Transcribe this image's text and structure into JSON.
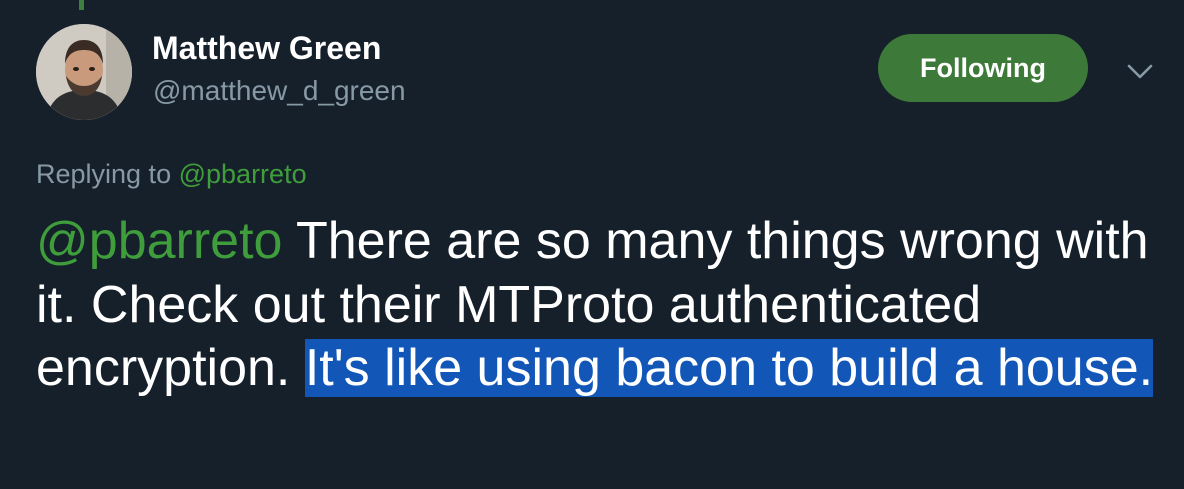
{
  "author": {
    "display_name": "Matthew Green",
    "handle": "@matthew_d_green"
  },
  "follow_button": {
    "label": "Following"
  },
  "caret": {
    "icon": "chevron-down-icon"
  },
  "reply_context": {
    "prefix": "Replying to",
    "mention": "@pbarreto"
  },
  "tweet": {
    "mention": "@pbarreto",
    "text_plain": " There are so many things wrong with it. Check out their MTProto authenticated encryption. ",
    "text_highlighted_line1": "It's like using bacon to build a ",
    "text_highlighted_line2": "house."
  },
  "colors": {
    "background": "#15202b",
    "accent_green": "#3d7a3a",
    "mention_green": "#3f9e3b",
    "secondary_text": "#8899a6",
    "selection_blue": "#1257b8"
  }
}
